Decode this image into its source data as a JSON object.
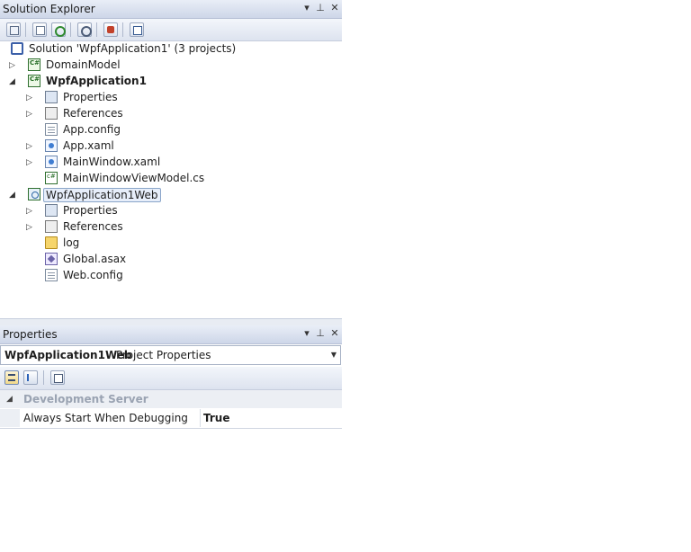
{
  "solution_explorer": {
    "title": "Solution Explorer",
    "controls": {
      "dropdown": "▾",
      "pin": "⊥",
      "close": "✕"
    },
    "toolbar": [
      "properties-icon",
      "show-all-files-icon",
      "refresh-icon",
      "view-code-icon",
      "view-designer-icon",
      "class-diagram-icon"
    ],
    "tree": [
      {
        "label": "Solution 'WpfApplication1' (3 projects)",
        "icon": "solution-icon",
        "level": 0,
        "expander": ""
      },
      {
        "label": "DomainModel",
        "icon": "csharp-project-icon",
        "level": 1,
        "expander": "▷"
      },
      {
        "label": "WpfApplication1",
        "icon": "csharp-project-icon",
        "level": 1,
        "expander": "◢",
        "bold": true
      },
      {
        "label": "Properties",
        "icon": "properties-folder-icon",
        "level": 2,
        "expander": "▷"
      },
      {
        "label": "References",
        "icon": "references-icon",
        "level": 2,
        "expander": "▷"
      },
      {
        "label": "App.config",
        "icon": "config-file-icon",
        "level": 2,
        "expander": ""
      },
      {
        "label": "App.xaml",
        "icon": "xaml-file-icon",
        "level": 2,
        "expander": "▷"
      },
      {
        "label": "MainWindow.xaml",
        "icon": "xaml-file-icon",
        "level": 2,
        "expander": "▷"
      },
      {
        "label": "MainWindowViewModel.cs",
        "icon": "csharp-file-icon",
        "level": 2,
        "expander": ""
      },
      {
        "label": "WpfApplication1Web",
        "icon": "web-project-icon",
        "level": 1,
        "expander": "◢",
        "selected": true
      },
      {
        "label": "Properties",
        "icon": "properties-folder-icon",
        "level": 2,
        "expander": "▷"
      },
      {
        "label": "References",
        "icon": "references-icon",
        "level": 2,
        "expander": "▷"
      },
      {
        "label": "log",
        "icon": "folder-icon",
        "level": 2,
        "expander": ""
      },
      {
        "label": "Global.asax",
        "icon": "asax-file-icon",
        "level": 2,
        "expander": ""
      },
      {
        "label": "Web.config",
        "icon": "config-file-icon",
        "level": 2,
        "expander": ""
      }
    ]
  },
  "properties": {
    "title": "Properties",
    "controls": {
      "dropdown": "▾",
      "pin": "⊥",
      "close": "✕"
    },
    "object_name": "WpfApplication1Web",
    "object_type": "Project Properties",
    "dropdown_glyph": "▼",
    "toolbar": [
      "categorized-icon",
      "alphabetical-icon",
      "property-pages-icon"
    ],
    "category": {
      "expander": "◢",
      "label": "Development Server"
    },
    "rows": [
      {
        "name": "Always Start When Debugging",
        "value": "True"
      }
    ]
  }
}
